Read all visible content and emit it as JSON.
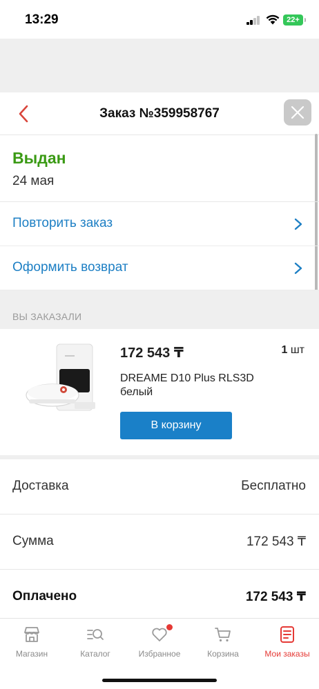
{
  "status_bar": {
    "time": "13:29",
    "battery": "22+"
  },
  "header": {
    "title": "Заказ №359958767"
  },
  "order_status": {
    "status": "Выдан",
    "date": "24 мая"
  },
  "actions": [
    {
      "label": "Повторить заказ"
    },
    {
      "label": "Оформить возврат"
    }
  ],
  "section_title": "ВЫ ЗАКАЗАЛИ",
  "product": {
    "price": "172 543 ₸",
    "quantity": "1",
    "quantity_unit": "шт",
    "name": "DREAME D10 Plus RLS3D белый",
    "cart_button": "В корзину"
  },
  "summary": [
    {
      "label": "Доставка",
      "value": "Бесплатно"
    },
    {
      "label": "Сумма",
      "value": "172 543 ₸"
    },
    {
      "label": "Оплачено",
      "value": "172 543 ₸"
    }
  ],
  "tabs": [
    {
      "label": "Магазин",
      "icon": "shop-icon",
      "active": false
    },
    {
      "label": "Каталог",
      "icon": "catalog-search-icon",
      "active": false
    },
    {
      "label": "Избранное",
      "icon": "heart-icon",
      "active": false
    },
    {
      "label": "Корзина",
      "icon": "cart-icon",
      "active": false
    },
    {
      "label": "Мои заказы",
      "icon": "orders-icon",
      "active": true
    }
  ],
  "colors": {
    "status_green": "#3a9a14",
    "link_blue": "#1d7fc4",
    "button_blue": "#1a80c8",
    "accent_red": "#e53935"
  }
}
